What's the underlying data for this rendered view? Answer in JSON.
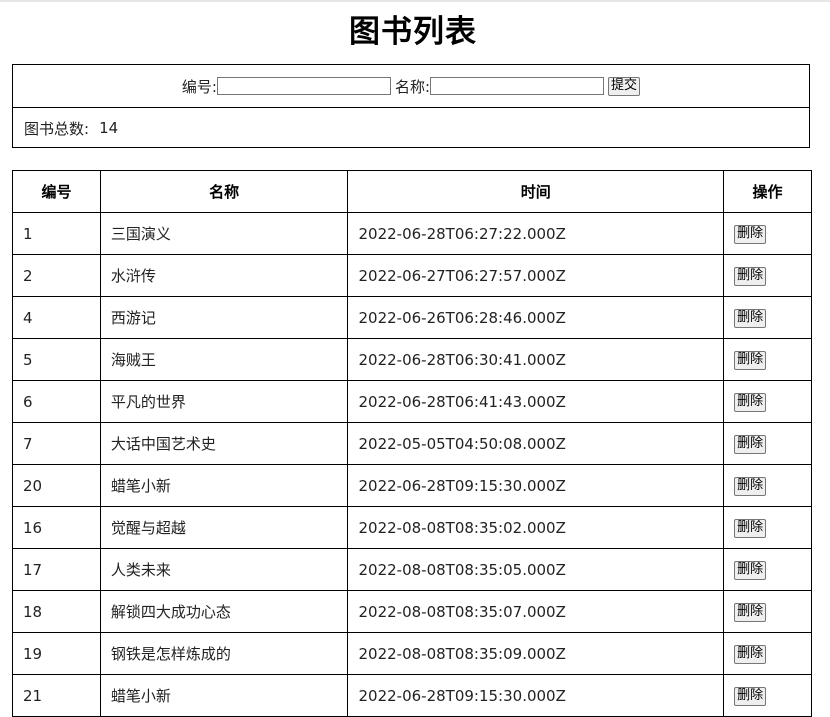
{
  "page": {
    "title": "图书列表"
  },
  "search": {
    "id_label": "编号:",
    "id_value": "",
    "name_label": "名称:",
    "name_value": "",
    "submit_label": "提交",
    "count_label": "图书总数:",
    "count_value": "14"
  },
  "table": {
    "headers": [
      "编号",
      "名称",
      "时间",
      "操作"
    ],
    "delete_label": "删除",
    "rows": [
      {
        "id": "1",
        "name": "三国演义",
        "time": "2022-06-28T06:27:22.000Z"
      },
      {
        "id": "2",
        "name": "水浒传",
        "time": "2022-06-27T06:27:57.000Z"
      },
      {
        "id": "4",
        "name": "西游记",
        "time": "2022-06-26T06:28:46.000Z"
      },
      {
        "id": "5",
        "name": "海贼王",
        "time": "2022-06-28T06:30:41.000Z"
      },
      {
        "id": "6",
        "name": "平凡的世界",
        "time": "2022-06-28T06:41:43.000Z"
      },
      {
        "id": "7",
        "name": "大话中国艺术史",
        "time": "2022-05-05T04:50:08.000Z"
      },
      {
        "id": "20",
        "name": "蜡笔小新",
        "time": "2022-06-28T09:15:30.000Z"
      },
      {
        "id": "16",
        "name": "觉醒与超越",
        "time": "2022-08-08T08:35:02.000Z"
      },
      {
        "id": "17",
        "name": "人类未来",
        "time": "2022-08-08T08:35:05.000Z"
      },
      {
        "id": "18",
        "name": "解锁四大成功心态",
        "time": "2022-08-08T08:35:07.000Z"
      },
      {
        "id": "19",
        "name": "钢铁是怎样炼成的",
        "time": "2022-08-08T08:35:09.000Z"
      },
      {
        "id": "21",
        "name": "蜡笔小新",
        "time": "2022-06-28T09:15:30.000Z"
      }
    ]
  }
}
